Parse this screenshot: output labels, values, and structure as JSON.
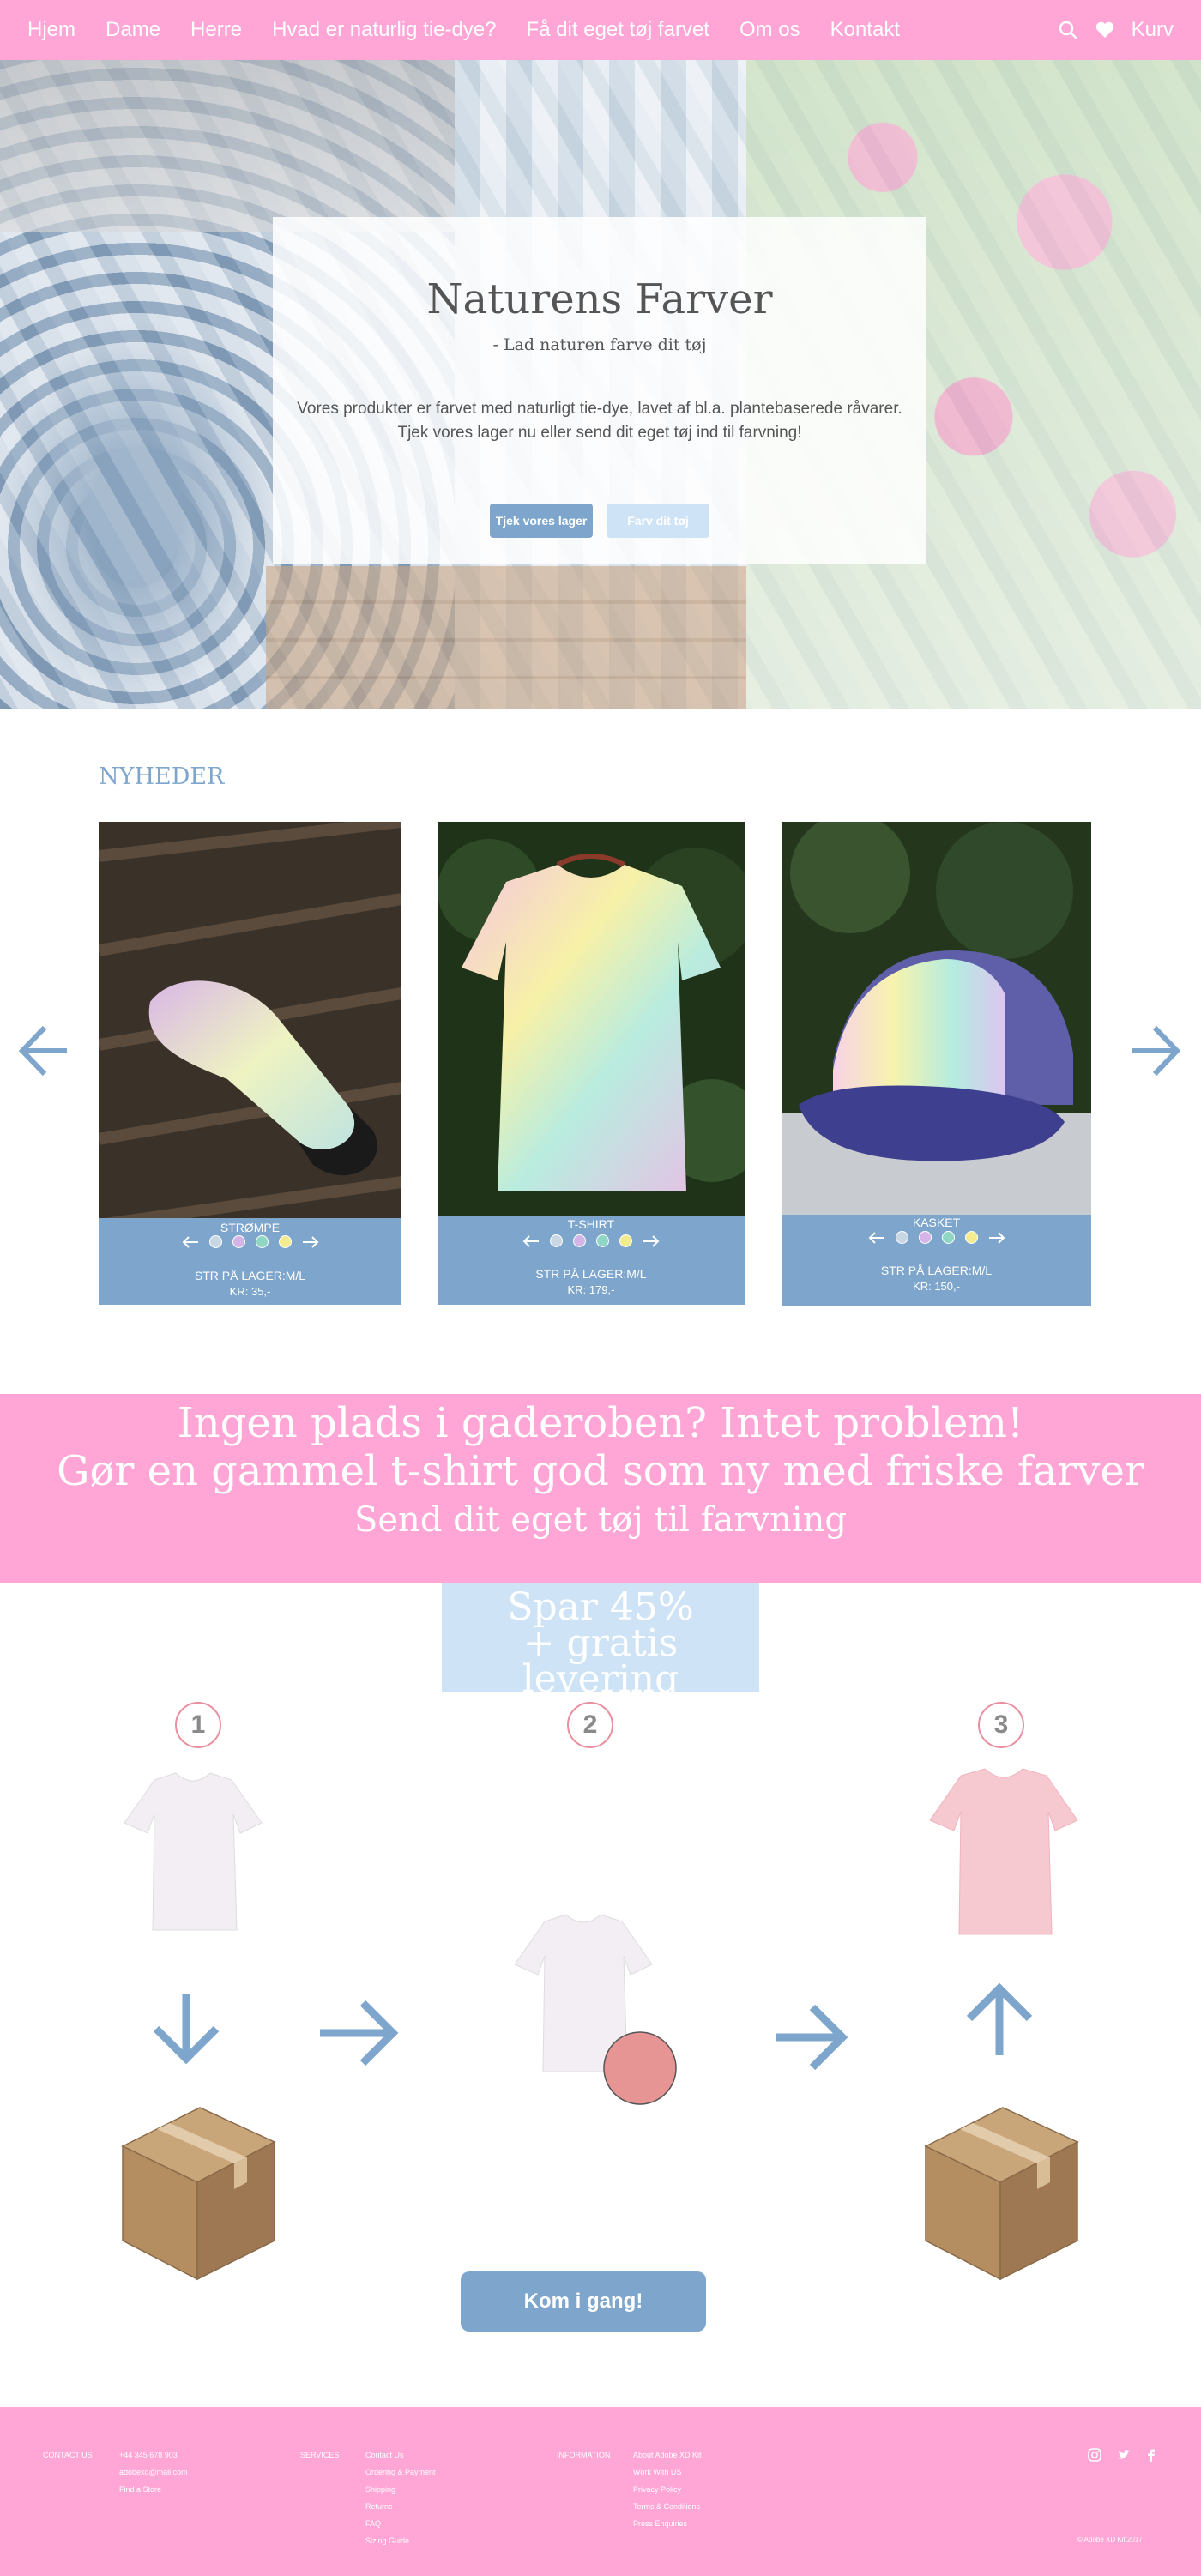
{
  "nav": {
    "links": [
      "Hjem",
      "Dame",
      "Herre",
      "Hvad er naturlig tie-dye?",
      "Få dit eget tøj farvet",
      "Om os",
      "Kontakt"
    ],
    "cart_label": "Kurv",
    "icons": [
      "search-icon",
      "heart-icon"
    ]
  },
  "hero": {
    "title": "Naturens Farver",
    "subtitle": "- Lad naturen farve dit tøj",
    "text_line1": "Vores produkter er farvet med naturligt tie-dye, lavet af bl.a. plantebaserede råvarer.",
    "text_line2": "Tjek vores lager nu eller send dit eget tøj ind til farvning!",
    "primary_button": "Tjek vores lager",
    "secondary_button": "Farv dit tøj"
  },
  "news": {
    "title": "NYHEDER",
    "products": [
      {
        "name": "STRØMPE",
        "size": "STR PÅ LAGER:M/L",
        "price": "KR: 35,-"
      },
      {
        "name": "T-SHIRT",
        "size": "STR PÅ LAGER:M/L",
        "price": "KR: 179,-"
      },
      {
        "name": "KASKET",
        "size": "STR PÅ LAGER:M/L",
        "price": "KR: 150,-"
      }
    ],
    "swatch_colors": [
      "#c9d7e4",
      "#d5b5e8",
      "#8fd6c4",
      "#f3ec8e"
    ]
  },
  "banner": {
    "line1": "Ingen plads i gaderoben? Intet problem!",
    "line2": "Gør en gammel t-shirt god som ny med friske farver",
    "line3": "Send dit eget tøj til farvning"
  },
  "discount": {
    "line1": "Spar 45%",
    "line2": "+ gratis levering"
  },
  "steps": {
    "numbers": [
      "1",
      "2",
      "3"
    ],
    "cta": "Kom i gang!"
  },
  "footer": {
    "contact": {
      "heading": "CONTACT US",
      "phone": "+44 345 678 903",
      "email": "adobexd@mail.com",
      "find": "Find a Store"
    },
    "services": {
      "heading": "SERVICES",
      "items": [
        "Contact Us",
        "Ordering & Payment",
        "Shipping",
        "Returns",
        "FAQ",
        "Sizing Guide"
      ]
    },
    "information": {
      "heading": "INFORMATION",
      "items": [
        "About Adobe XD Kit",
        "Work With US",
        "Privacy Policy",
        "Terms & Conditions",
        "Press Enquiries"
      ]
    },
    "copyright": "© Adobe XD Kit 2017",
    "social_icons": [
      "instagram-icon",
      "twitter-icon",
      "facebook-icon"
    ]
  },
  "colors": {
    "brand_pink": "#ffa6d6",
    "brand_blue": "#7ea6cd",
    "light_blue": "#cfe3f6"
  }
}
